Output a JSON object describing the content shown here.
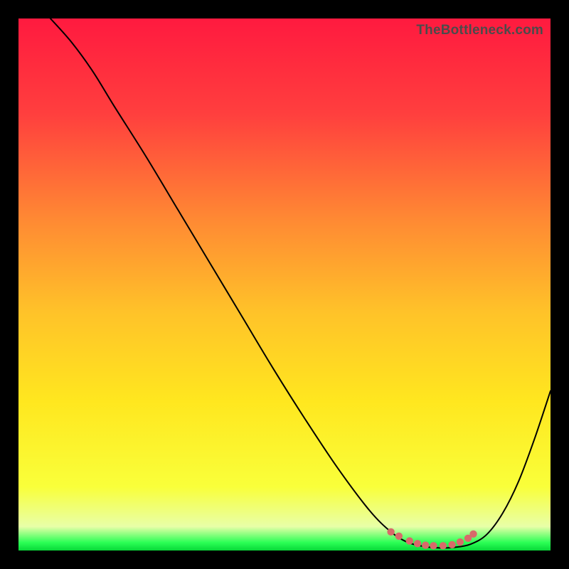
{
  "watermark": "TheBottleneck.com",
  "chart_data": {
    "type": "line",
    "title": "",
    "xlabel": "",
    "ylabel": "",
    "xlim": [
      0,
      100
    ],
    "ylim": [
      0,
      100
    ],
    "gradient_stops": [
      {
        "offset": 0.0,
        "color": "#ff1a3f"
      },
      {
        "offset": 0.18,
        "color": "#ff3f3e"
      },
      {
        "offset": 0.38,
        "color": "#ff8a33"
      },
      {
        "offset": 0.55,
        "color": "#ffc229"
      },
      {
        "offset": 0.72,
        "color": "#ffe71f"
      },
      {
        "offset": 0.88,
        "color": "#f9ff3a"
      },
      {
        "offset": 0.955,
        "color": "#e8ffa8"
      },
      {
        "offset": 0.985,
        "color": "#2bff55"
      },
      {
        "offset": 1.0,
        "color": "#08d838"
      }
    ],
    "series": [
      {
        "name": "bottleneck-curve",
        "color": "#000000",
        "width": 2.0,
        "x": [
          6.0,
          10.0,
          14.0,
          18.0,
          24.0,
          30.0,
          36.0,
          42.0,
          48.0,
          54.0,
          60.0,
          66.0,
          70.0,
          73.0,
          76.0,
          79.0,
          82.0,
          85.0,
          88.0,
          91.0,
          94.0,
          97.0,
          100.0
        ],
        "y": [
          100.0,
          95.5,
          90.0,
          83.5,
          74.0,
          64.0,
          54.0,
          44.0,
          34.0,
          24.5,
          15.5,
          7.5,
          3.5,
          1.6,
          0.8,
          0.5,
          0.6,
          1.2,
          3.0,
          7.0,
          13.0,
          21.0,
          30.0
        ]
      },
      {
        "name": "highlight-dots",
        "color": "#d86a6a",
        "marker_size": 5.2,
        "x": [
          70.0,
          71.5,
          73.5,
          75.0,
          76.5,
          78.0,
          79.8,
          81.5,
          83.0,
          84.5,
          85.5
        ],
        "y": [
          3.5,
          2.7,
          1.8,
          1.3,
          1.0,
          0.9,
          0.9,
          1.1,
          1.6,
          2.3,
          3.1
        ]
      }
    ]
  }
}
